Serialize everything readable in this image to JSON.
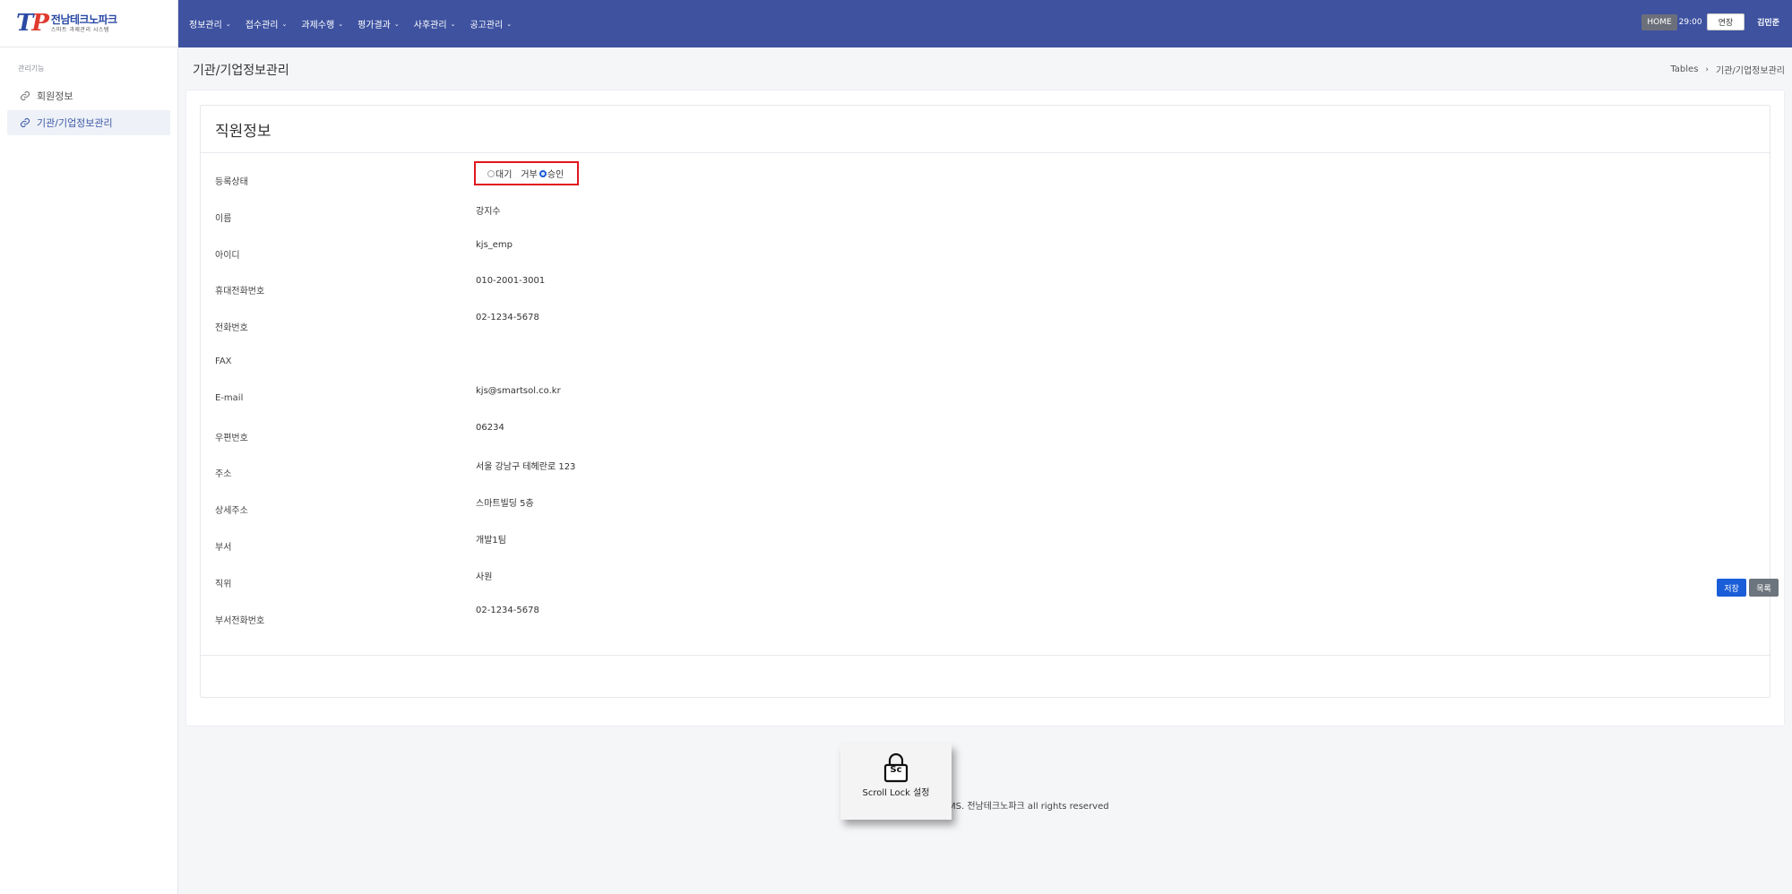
{
  "logo": {
    "mark": "TP",
    "name": "전남테크노파크",
    "tagline": "스마트 과제관리 시스템"
  },
  "sidebar": {
    "section_title": "관리기능",
    "items": [
      {
        "label": "회원정보",
        "active": false
      },
      {
        "label": "기관/기업정보관리",
        "active": true
      }
    ]
  },
  "topbar": {
    "menu": [
      "정보관리",
      "접수관리",
      "과제수행",
      "평가결과",
      "사후관리",
      "공고관리"
    ],
    "home_label": "HOME",
    "timer": "29:00",
    "extend_label": "연장",
    "user_name": "김민준"
  },
  "page": {
    "title": "기관/기업정보관리",
    "breadcrumb": [
      "Tables",
      "기관/기업정보관리"
    ]
  },
  "form": {
    "heading": "직원정보",
    "status_label": "등록상태",
    "status_options": [
      {
        "label": "대기",
        "checked": false
      },
      {
        "label": "거부",
        "checked": false
      },
      {
        "label": "승인",
        "checked": true
      }
    ],
    "fields": [
      {
        "label": "이름",
        "value": "강지수"
      },
      {
        "label": "아이디",
        "value": "kjs_emp"
      },
      {
        "label": "휴대전화번호",
        "value": "010-2001-3001"
      },
      {
        "label": "전화번호",
        "value": "02-1234-5678"
      },
      {
        "label": "FAX",
        "value": ""
      },
      {
        "label": "E-mail",
        "value": "kjs@smartsol.co.kr"
      },
      {
        "label": "우편번호",
        "value": "06234"
      },
      {
        "label": "주소",
        "value": "서울 강남구 테헤란로 123"
      },
      {
        "label": "상세주소",
        "value": "스마트빌딩 5층"
      },
      {
        "label": "부서",
        "value": "개발1팀"
      },
      {
        "label": "직위",
        "value": "사원"
      },
      {
        "label": "부서전화번호",
        "value": "02-1234-5678"
      }
    ],
    "save_label": "저장",
    "list_label": "목록"
  },
  "footer": {
    "text": "MS. 전남테크노파크 all rights reserved"
  },
  "scroll_lock": {
    "key_label": "Sc",
    "label": "Scroll Lock 설정"
  },
  "colors": {
    "topbar": "#3e52a0",
    "primary_button": "#1a5dd8",
    "secondary_button": "#6c757d",
    "highlight_box": "#e0161e"
  }
}
